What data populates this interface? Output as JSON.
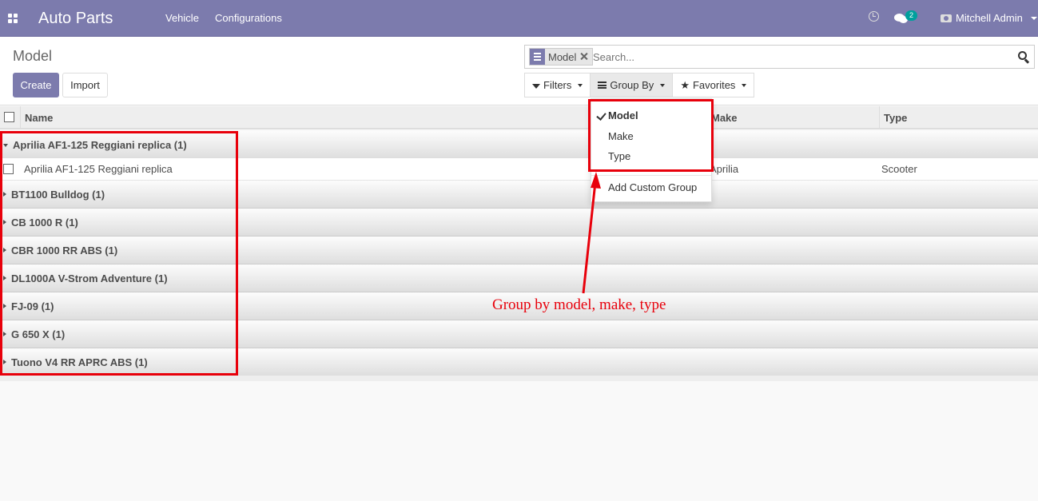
{
  "navbar": {
    "app_title": "Auto Parts",
    "menus": [
      "Vehicle",
      "Configurations"
    ],
    "chat_count": "2",
    "user_name": "Mitchell Admin",
    "color": "#7c7bad"
  },
  "control_panel": {
    "breadcrumb": "Model",
    "create_label": "Create",
    "import_label": "Import"
  },
  "search": {
    "facet_label": "Model",
    "facet_icon": "bars-icon",
    "placeholder": "Search..."
  },
  "search_buttons": {
    "filters": "Filters",
    "group_by": "Group By",
    "favorites": "Favorites"
  },
  "group_by_menu": {
    "items": [
      {
        "label": "Model",
        "selected": true
      },
      {
        "label": "Make",
        "selected": false
      },
      {
        "label": "Type",
        "selected": false
      }
    ],
    "custom": "Add Custom Group"
  },
  "table": {
    "columns": [
      "Name",
      "Make",
      "Type"
    ],
    "groups": [
      {
        "label": "Aprilia AF1-125 Reggiani replica (1)",
        "expanded": true
      },
      {
        "label": "BT1100 Bulldog (1)",
        "expanded": false
      },
      {
        "label": "CB 1000 R (1)",
        "expanded": false
      },
      {
        "label": "CBR 1000 RR ABS (1)",
        "expanded": false
      },
      {
        "label": "DL1000A V-Strom Adventure (1)",
        "expanded": false
      },
      {
        "label": "FJ-09 (1)",
        "expanded": false
      },
      {
        "label": "G 650 X (1)",
        "expanded": false
      },
      {
        "label": "Tuono V4 RR APRC ABS (1)",
        "expanded": false
      }
    ],
    "row": {
      "name": "Aprilia AF1-125 Reggiani replica",
      "make": "Aprilia",
      "type": "Scooter"
    }
  },
  "annotation": {
    "text": "Group by model, make, type",
    "color": "#e8000b"
  }
}
